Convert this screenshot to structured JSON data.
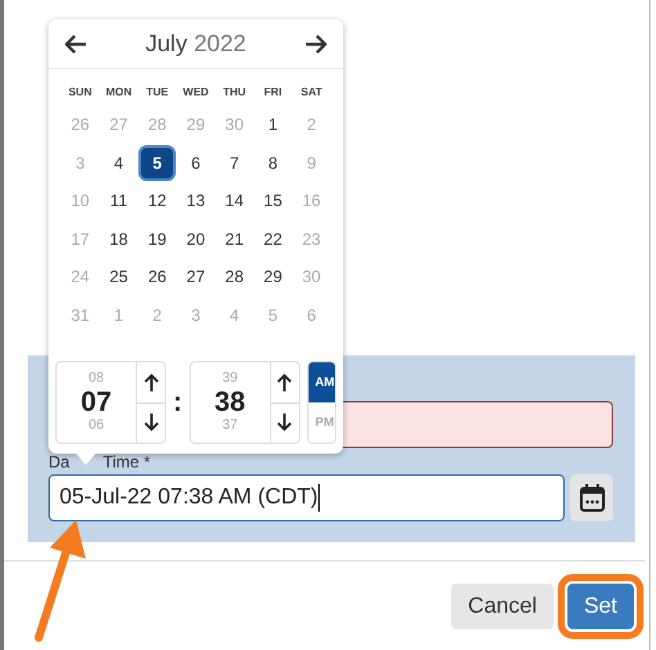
{
  "calendar": {
    "month": "July",
    "year": "2022",
    "weekdays": [
      "SUN",
      "MON",
      "TUE",
      "WED",
      "THU",
      "FRI",
      "SAT"
    ],
    "days": [
      {
        "label": "26",
        "muted": true,
        "selected": false
      },
      {
        "label": "27",
        "muted": true,
        "selected": false
      },
      {
        "label": "28",
        "muted": true,
        "selected": false
      },
      {
        "label": "29",
        "muted": true,
        "selected": false
      },
      {
        "label": "30",
        "muted": true,
        "selected": false
      },
      {
        "label": "1",
        "muted": false,
        "selected": false
      },
      {
        "label": "2",
        "muted": true,
        "selected": false
      },
      {
        "label": "3",
        "muted": true,
        "selected": false
      },
      {
        "label": "4",
        "muted": false,
        "selected": false
      },
      {
        "label": "5",
        "muted": false,
        "selected": true
      },
      {
        "label": "6",
        "muted": false,
        "selected": false
      },
      {
        "label": "7",
        "muted": false,
        "selected": false
      },
      {
        "label": "8",
        "muted": false,
        "selected": false
      },
      {
        "label": "9",
        "muted": true,
        "selected": false
      },
      {
        "label": "10",
        "muted": true,
        "selected": false
      },
      {
        "label": "11",
        "muted": false,
        "selected": false
      },
      {
        "label": "12",
        "muted": false,
        "selected": false
      },
      {
        "label": "13",
        "muted": false,
        "selected": false
      },
      {
        "label": "14",
        "muted": false,
        "selected": false
      },
      {
        "label": "15",
        "muted": false,
        "selected": false
      },
      {
        "label": "16",
        "muted": true,
        "selected": false
      },
      {
        "label": "17",
        "muted": true,
        "selected": false
      },
      {
        "label": "18",
        "muted": false,
        "selected": false
      },
      {
        "label": "19",
        "muted": false,
        "selected": false
      },
      {
        "label": "20",
        "muted": false,
        "selected": false
      },
      {
        "label": "21",
        "muted": false,
        "selected": false
      },
      {
        "label": "22",
        "muted": false,
        "selected": false
      },
      {
        "label": "23",
        "muted": true,
        "selected": false
      },
      {
        "label": "24",
        "muted": true,
        "selected": false
      },
      {
        "label": "25",
        "muted": false,
        "selected": false
      },
      {
        "label": "26",
        "muted": false,
        "selected": false
      },
      {
        "label": "27",
        "muted": false,
        "selected": false
      },
      {
        "label": "28",
        "muted": false,
        "selected": false
      },
      {
        "label": "29",
        "muted": false,
        "selected": false
      },
      {
        "label": "30",
        "muted": true,
        "selected": false
      },
      {
        "label": "31",
        "muted": true,
        "selected": false
      },
      {
        "label": "1",
        "muted": true,
        "selected": false
      },
      {
        "label": "2",
        "muted": true,
        "selected": false
      },
      {
        "label": "3",
        "muted": true,
        "selected": false
      },
      {
        "label": "4",
        "muted": true,
        "selected": false
      },
      {
        "label": "5",
        "muted": true,
        "selected": false
      },
      {
        "label": "6",
        "muted": true,
        "selected": false
      }
    ]
  },
  "time": {
    "hour": {
      "above": "08",
      "value": "07",
      "below": "06"
    },
    "separator": ":",
    "minute": {
      "above": "39",
      "value": "38",
      "below": "37"
    },
    "meridiem": [
      {
        "label": "AM",
        "selected": true
      },
      {
        "label": "PM",
        "selected": false
      }
    ]
  },
  "form": {
    "first_field": {
      "invalid": true
    },
    "label_parts": [
      "Da",
      "Time *"
    ],
    "date_time": {
      "value": "05-Jul-22 07:38 AM (CDT)"
    }
  },
  "buttons": [
    {
      "label": "Cancel",
      "kind": "secondary",
      "highlighted": false
    },
    {
      "label": "Set",
      "kind": "primary",
      "highlighted": true
    }
  ]
}
